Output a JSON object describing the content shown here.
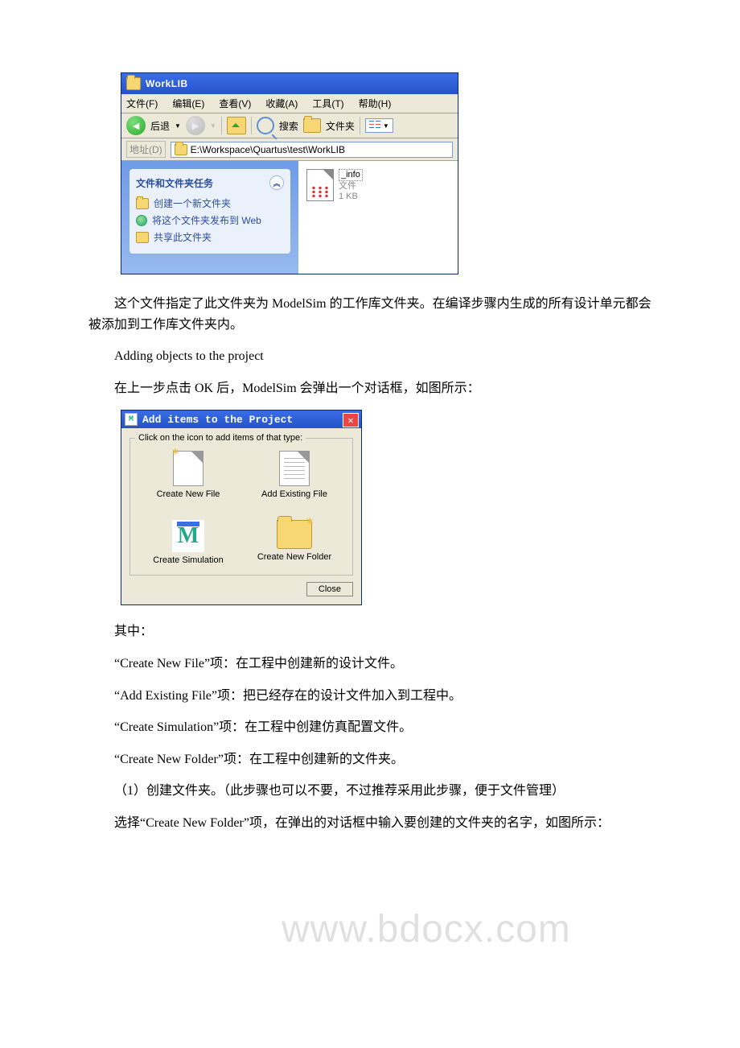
{
  "explorer": {
    "title": "WorkLIB",
    "menu": {
      "file": "文件(F)",
      "edit": "编辑(E)",
      "view": "查看(V)",
      "fav": "收藏(A)",
      "tools": "工具(T)",
      "help": "帮助(H)"
    },
    "toolbar": {
      "back": "后退",
      "search": "搜索",
      "folders": "文件夹"
    },
    "address": {
      "label": "地址(D)",
      "path": "E:\\Workspace\\Quartus\\test\\WorkLIB"
    },
    "tasks": {
      "header": "文件和文件夹任务",
      "t1": "创建一个新文件夹",
      "t2": "将这个文件夹发布到 Web",
      "t3": "共享此文件夹"
    },
    "file": {
      "name": "_info",
      "type": "文件",
      "size": "1 KB"
    }
  },
  "para": {
    "p1": "这个文件指定了此文件夹为 ModelSim 的工作库文件夹。在编译步骤内生成的所有设计单元都会被添加到工作库文件夹内。",
    "p2": "Adding objects to the project",
    "p3": "在上一步点击 OK 后，ModelSim 会弹出一个对话框，如图所示：",
    "p4": "其中：",
    "p5": "“Create New File”项：在工程中创建新的设计文件。",
    "p6": "“Add Existing File”项：把已经存在的设计文件加入到工程中。",
    "p7": "“Create Simulation”项：在工程中创建仿真配置文件。",
    "p8": "“Create New Folder”项：在工程中创建新的文件夹。",
    "p9": "（1）创建文件夹。（此步骤也可以不要，不过推荐采用此步骤，便于文件管理）",
    "p10": "选择“Create New Folder”项，在弹出的对话框中输入要创建的文件夹的名字，如图所示："
  },
  "dialog": {
    "title": "Add items to the Project",
    "legend": "Click on the icon to add items of that type:",
    "items": {
      "newFile": "Create New File",
      "addFile": "Add Existing File",
      "createSim": "Create Simulation",
      "newFolder": "Create New Folder"
    },
    "close": "Close"
  },
  "watermark": "www.bdocx.com"
}
